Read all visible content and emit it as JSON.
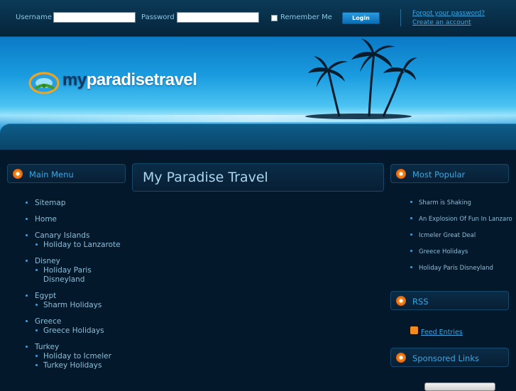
{
  "login": {
    "username_label": "Username",
    "username_value": "",
    "password_label": "Password",
    "password_value": "",
    "remember_label": "Remember Me",
    "login_button": "Login",
    "forgot_link": "Forgot your password?",
    "create_link": "Create an account"
  },
  "site": {
    "logo_prefix": "my",
    "logo_rest": "paradisetravel"
  },
  "main_menu": {
    "title": "Main Menu",
    "items": [
      {
        "label": "Sitemap"
      },
      {
        "label": "Home"
      },
      {
        "label": "Canary Islands"
      },
      {
        "label": "Holiday to Lanzarote"
      },
      {
        "label": "Disney"
      },
      {
        "label": "Holiday Paris"
      },
      {
        "label": "Disneyland"
      },
      {
        "label": "Egypt"
      },
      {
        "label": "Sharm Holidays"
      },
      {
        "label": "Greece"
      },
      {
        "label": "Greece Holidays"
      },
      {
        "label": "Turkey"
      },
      {
        "label": "Holiday to Icmeler"
      },
      {
        "label": "Turkey Holidays"
      }
    ]
  },
  "center": {
    "title": "My Paradise Travel"
  },
  "popular": {
    "title": "Most Popular",
    "items": [
      "Sharm is Shaking",
      "An Explosion Of Fun In Lanzaro",
      "Icmeler Great Deal",
      "Greece Holidays",
      "Holiday Paris Disneyland"
    ]
  },
  "rss": {
    "title": "RSS",
    "feed_label": "Feed Entries"
  },
  "sponsored": {
    "title": "Sponsored Links"
  },
  "colors": {
    "accent": "#3aa7e3",
    "background": "#03182a",
    "icon_orange": "#f28a1c"
  }
}
